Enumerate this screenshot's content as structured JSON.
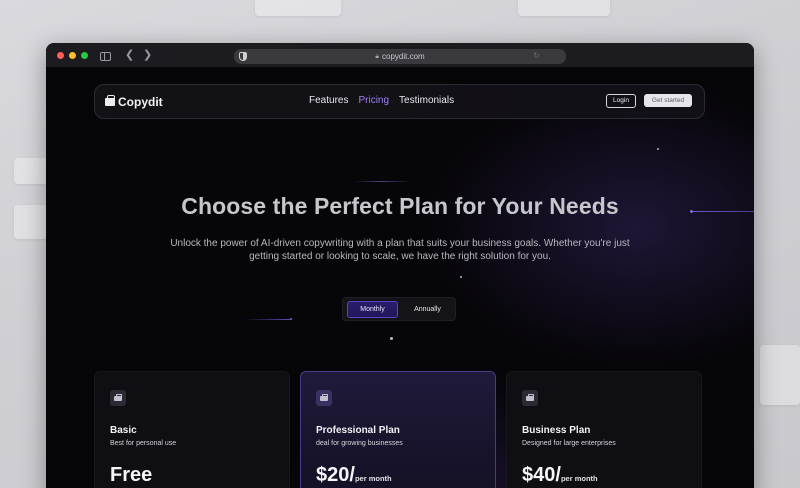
{
  "browser": {
    "url": "copydit.com"
  },
  "nav": {
    "brand": "Copydit",
    "links": [
      "Features",
      "Pricing",
      "Testimonials"
    ],
    "active_link": "Pricing",
    "login_label": "Login",
    "get_started_label": "Get started"
  },
  "hero": {
    "title": "Choose the Perfect Plan for Your Needs",
    "subtitle_line1": "Unlock the power of AI-driven copywriting with a plan that suits your business goals. Whether you're just",
    "subtitle_line2": "getting started or looking to scale, we have the right solution for you."
  },
  "billing_toggle": {
    "monthly": "Monthly",
    "annually": "Annually",
    "selected": "Monthly"
  },
  "plans": [
    {
      "name": "Basic",
      "description": "Best for personal use",
      "price": "Free",
      "period": ""
    },
    {
      "name": "Professional Plan",
      "description": "deal for growing businesses",
      "price": "$20/",
      "period": "per month",
      "highlighted": true
    },
    {
      "name": "Business Plan",
      "description": "Designed for large enterprises",
      "price": "$40/",
      "period": "per month"
    }
  ],
  "colors": {
    "accent": "#a07ef5",
    "toggle_active": "#2a1c6b",
    "page_background": "#060508"
  }
}
